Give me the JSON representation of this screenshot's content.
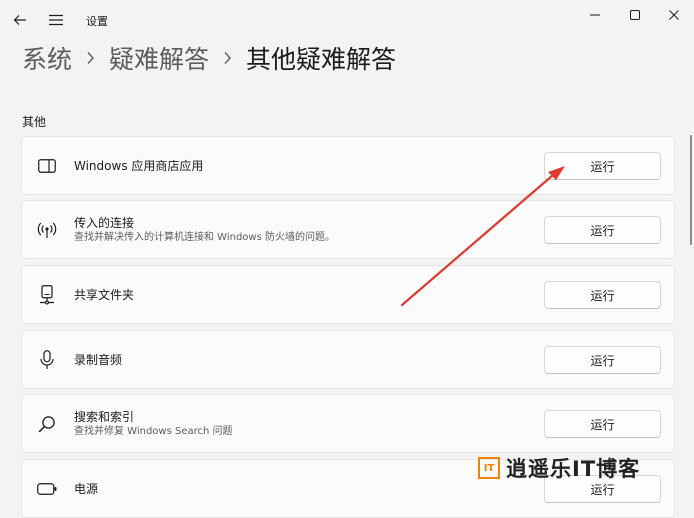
{
  "titlebar": {
    "back_icon": "back-arrow-icon",
    "menu_icon": "hamburger-menu-icon",
    "app_title": "设置",
    "minimize_icon": "minimize-icon",
    "maximize_icon": "maximize-icon",
    "close_icon": "close-icon"
  },
  "breadcrumb": {
    "items": [
      "系统",
      "疑难解答",
      "其他疑难解答"
    ]
  },
  "section": {
    "label": "其他"
  },
  "troubleshooters": [
    {
      "icon": "store-app-icon",
      "title": "Windows 应用商店应用",
      "desc": "",
      "button": "运行"
    },
    {
      "icon": "wireless-signal-icon",
      "title": "传入的连接",
      "desc": "查找并解决传入的计算机连接和 Windows 防火墙的问题。",
      "button": "运行"
    },
    {
      "icon": "network-drive-icon",
      "title": "共享文件夹",
      "desc": "",
      "button": "运行"
    },
    {
      "icon": "microphone-icon",
      "title": "录制音频",
      "desc": "",
      "button": "运行"
    },
    {
      "icon": "search-icon",
      "title": "搜索和索引",
      "desc": "查找并修复 Windows Search 问题",
      "button": "运行"
    },
    {
      "icon": "battery-icon",
      "title": "电源",
      "desc": "",
      "button": "运行"
    }
  ],
  "watermark": {
    "text": "逍遥乐IT博客",
    "logo_text": "IT",
    "color": "#f08400"
  },
  "annotation": {
    "arrow_color": "#e0392f"
  }
}
